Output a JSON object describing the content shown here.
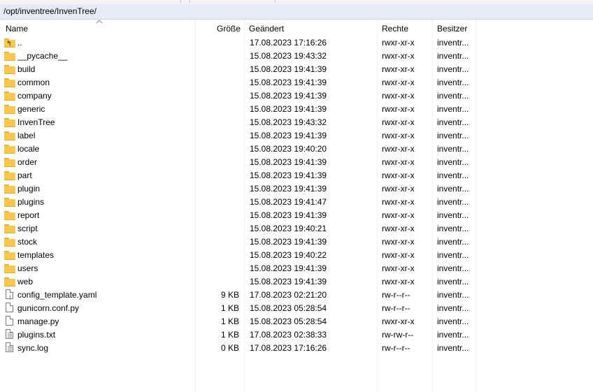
{
  "path": "/opt/inventree/InvenTree/",
  "columns": {
    "name": "Name",
    "size": "Größe",
    "modified": "Geändert",
    "permissions": "Rechte",
    "owner": "Besitzer"
  },
  "rows": [
    {
      "name": "..",
      "type": "up-folder",
      "size": "",
      "modified": "17.08.2023 17:16:26",
      "permissions": "rwxr-xr-x",
      "owner": "inventr..."
    },
    {
      "name": "__pycache__",
      "type": "folder",
      "size": "",
      "modified": "15.08.2023 19:43:32",
      "permissions": "rwxr-xr-x",
      "owner": "inventr..."
    },
    {
      "name": "build",
      "type": "folder",
      "size": "",
      "modified": "15.08.2023 19:41:39",
      "permissions": "rwxr-xr-x",
      "owner": "inventr..."
    },
    {
      "name": "common",
      "type": "folder",
      "size": "",
      "modified": "15.08.2023 19:41:39",
      "permissions": "rwxr-xr-x",
      "owner": "inventr..."
    },
    {
      "name": "company",
      "type": "folder",
      "size": "",
      "modified": "15.08.2023 19:41:39",
      "permissions": "rwxr-xr-x",
      "owner": "inventr..."
    },
    {
      "name": "generic",
      "type": "folder",
      "size": "",
      "modified": "15.08.2023 19:41:39",
      "permissions": "rwxr-xr-x",
      "owner": "inventr..."
    },
    {
      "name": "InvenTree",
      "type": "folder",
      "size": "",
      "modified": "15.08.2023 19:43:32",
      "permissions": "rwxr-xr-x",
      "owner": "inventr..."
    },
    {
      "name": "label",
      "type": "folder",
      "size": "",
      "modified": "15.08.2023 19:41:39",
      "permissions": "rwxr-xr-x",
      "owner": "inventr..."
    },
    {
      "name": "locale",
      "type": "folder",
      "size": "",
      "modified": "15.08.2023 19:40:20",
      "permissions": "rwxr-xr-x",
      "owner": "inventr..."
    },
    {
      "name": "order",
      "type": "folder",
      "size": "",
      "modified": "15.08.2023 19:41:39",
      "permissions": "rwxr-xr-x",
      "owner": "inventr..."
    },
    {
      "name": "part",
      "type": "folder",
      "size": "",
      "modified": "15.08.2023 19:41:39",
      "permissions": "rwxr-xr-x",
      "owner": "inventr..."
    },
    {
      "name": "plugin",
      "type": "folder",
      "size": "",
      "modified": "15.08.2023 19:41:39",
      "permissions": "rwxr-xr-x",
      "owner": "inventr..."
    },
    {
      "name": "plugins",
      "type": "folder",
      "size": "",
      "modified": "15.08.2023 19:41:47",
      "permissions": "rwxr-xr-x",
      "owner": "inventr..."
    },
    {
      "name": "report",
      "type": "folder",
      "size": "",
      "modified": "15.08.2023 19:41:39",
      "permissions": "rwxr-xr-x",
      "owner": "inventr..."
    },
    {
      "name": "script",
      "type": "folder",
      "size": "",
      "modified": "15.08.2023 19:40:21",
      "permissions": "rwxr-xr-x",
      "owner": "inventr..."
    },
    {
      "name": "stock",
      "type": "folder",
      "size": "",
      "modified": "15.08.2023 19:41:39",
      "permissions": "rwxr-xr-x",
      "owner": "inventr..."
    },
    {
      "name": "templates",
      "type": "folder",
      "size": "",
      "modified": "15.08.2023 19:40:22",
      "permissions": "rwxr-xr-x",
      "owner": "inventr..."
    },
    {
      "name": "users",
      "type": "folder",
      "size": "",
      "modified": "15.08.2023 19:41:39",
      "permissions": "rwxr-xr-x",
      "owner": "inventr..."
    },
    {
      "name": "web",
      "type": "folder",
      "size": "",
      "modified": "15.08.2023 19:41:39",
      "permissions": "rwxr-xr-x",
      "owner": "inventr..."
    },
    {
      "name": "config_template.yaml",
      "type": "yaml-file",
      "size": "9 KB",
      "modified": "17.08.2023 02:21:20",
      "permissions": "rw-r--r--",
      "owner": "inventr..."
    },
    {
      "name": "gunicorn.conf.py",
      "type": "file",
      "size": "1 KB",
      "modified": "15.08.2023 05:28:54",
      "permissions": "rw-r--r--",
      "owner": "inventr..."
    },
    {
      "name": "manage.py",
      "type": "file",
      "size": "1 KB",
      "modified": "15.08.2023 05:28:54",
      "permissions": "rwxr-xr-x",
      "owner": "inventr..."
    },
    {
      "name": "plugins.txt",
      "type": "text-file",
      "size": "1 KB",
      "modified": "17.08.2023 02:38:33",
      "permissions": "rw-rw-r--",
      "owner": "inventr..."
    },
    {
      "name": "sync.log",
      "type": "text-file",
      "size": "0 KB",
      "modified": "17.08.2023 17:16:26",
      "permissions": "rw-r--r--",
      "owner": "inventr..."
    }
  ]
}
